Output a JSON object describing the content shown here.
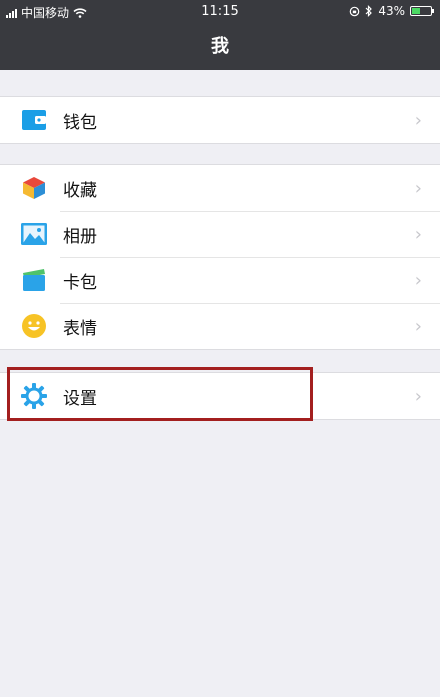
{
  "status": {
    "carrier": "中国移动",
    "time": "11:15",
    "battery_percent_text": "43%",
    "battery_level": 0.43
  },
  "header": {
    "title": "我"
  },
  "groups": [
    {
      "items": [
        {
          "label": "钱包",
          "icon": "wallet-icon"
        }
      ]
    },
    {
      "items": [
        {
          "label": "收藏",
          "icon": "favorites-cube-icon"
        },
        {
          "label": "相册",
          "icon": "photo-album-icon"
        },
        {
          "label": "卡包",
          "icon": "card-pack-icon"
        },
        {
          "label": "表情",
          "icon": "emoji-smile-icon"
        }
      ]
    },
    {
      "items": [
        {
          "label": "设置",
          "icon": "settings-gear-icon"
        }
      ]
    }
  ],
  "colors": {
    "nav_bg": "#393a3f",
    "page_bg": "#efeff4",
    "highlight_border": "#a31f1f"
  }
}
